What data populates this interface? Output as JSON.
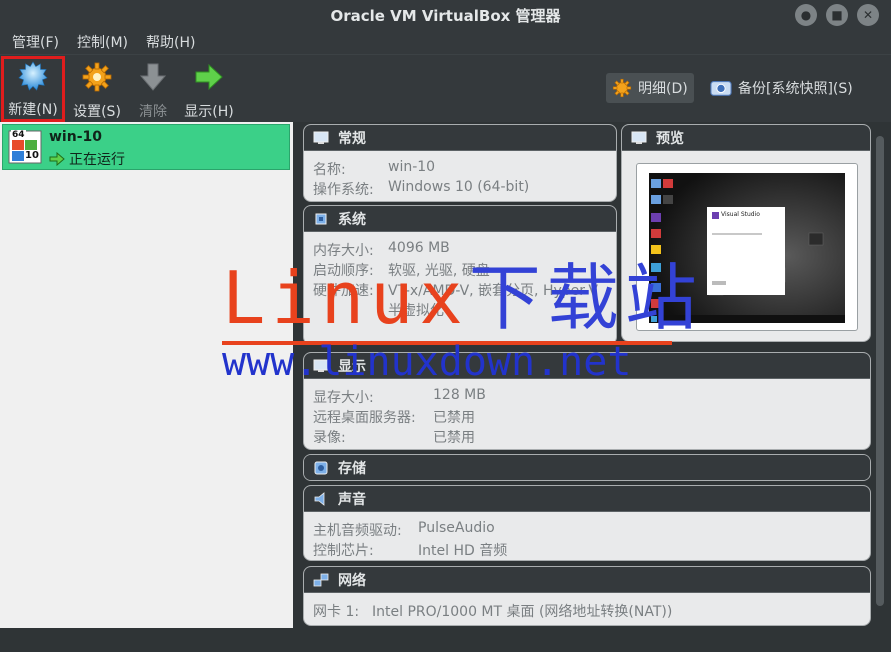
{
  "window": {
    "title": "Oracle VM VirtualBox 管理器"
  },
  "menu": {
    "items": [
      "管理(F)",
      "控制(M)",
      "帮助(H)"
    ]
  },
  "toolbar": {
    "new_label": "新建(N)",
    "settings_label": "设置(S)",
    "discard_label": "清除",
    "show_label": "显示(H)",
    "details_label": "明细(D)",
    "snapshots_label": "备份[系统快照](S)"
  },
  "vm": {
    "name": "win-10",
    "state": "正在运行",
    "os_badge_top": "64",
    "os_badge_bottom": "10"
  },
  "sections": {
    "general": {
      "title": "常规",
      "rows": [
        {
          "k": "名称:",
          "v": "win-10"
        },
        {
          "k": "操作系统:",
          "v": "Windows 10 (64-bit)"
        }
      ]
    },
    "system": {
      "title": "系统",
      "rows": [
        {
          "k": "内存大小:",
          "v": "4096 MB"
        },
        {
          "k": "启动顺序:",
          "v": "软驱, 光驱, 硬盘"
        },
        {
          "k": "硬件加速:",
          "v": "VT-x/AMD-V, 嵌套分页, Hyper-V"
        },
        {
          "k": "",
          "v": "半虚拟化"
        }
      ]
    },
    "preview": {
      "title": "预览",
      "screen_title": "Visual Studio"
    },
    "display": {
      "title": "显示",
      "rows": [
        {
          "k": "显存大小:",
          "v": "128 MB"
        },
        {
          "k": "远程桌面服务器:",
          "v": "已禁用"
        },
        {
          "k": "录像:",
          "v": "已禁用"
        }
      ]
    },
    "storage": {
      "title": "存储"
    },
    "audio": {
      "title": "声音",
      "rows": [
        {
          "k": "主机音频驱动:",
          "v": "PulseAudio"
        },
        {
          "k": "控制芯片:",
          "v": "Intel HD 音频"
        }
      ]
    },
    "network": {
      "title": "网络",
      "rows": [
        {
          "k": "网卡 1:",
          "v": "Intel PRO/1000 MT 桌面 (网络地址转换(NAT))"
        }
      ]
    }
  },
  "watermark": {
    "brand": "Linux",
    "brand_cn": "下载站",
    "url": "www.linuxdown.net"
  },
  "colors": {
    "running_green": "#3bd088",
    "selection_red": "#e01d1d",
    "watermark_red": "#e8421d",
    "watermark_blue": "#2233cc"
  }
}
